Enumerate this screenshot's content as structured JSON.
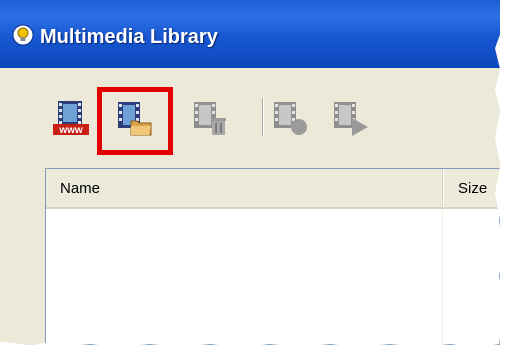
{
  "window": {
    "title": "Multimedia Library",
    "icon": "lightbulb-icon"
  },
  "toolbar": {
    "buttons": [
      {
        "name": "add-from-web",
        "icon": "film-www-icon",
        "enabled": true,
        "label": "www"
      },
      {
        "name": "add-from-folder",
        "icon": "film-folder-icon",
        "enabled": true,
        "highlighted": true
      },
      {
        "name": "delete",
        "icon": "film-trash-icon",
        "enabled": false
      },
      {
        "name": "record",
        "icon": "film-record-icon",
        "enabled": false
      },
      {
        "name": "play",
        "icon": "film-play-icon",
        "enabled": false
      }
    ],
    "highlight_color": "#e30000"
  },
  "list": {
    "columns": [
      "Name",
      "Size"
    ],
    "rows": []
  }
}
